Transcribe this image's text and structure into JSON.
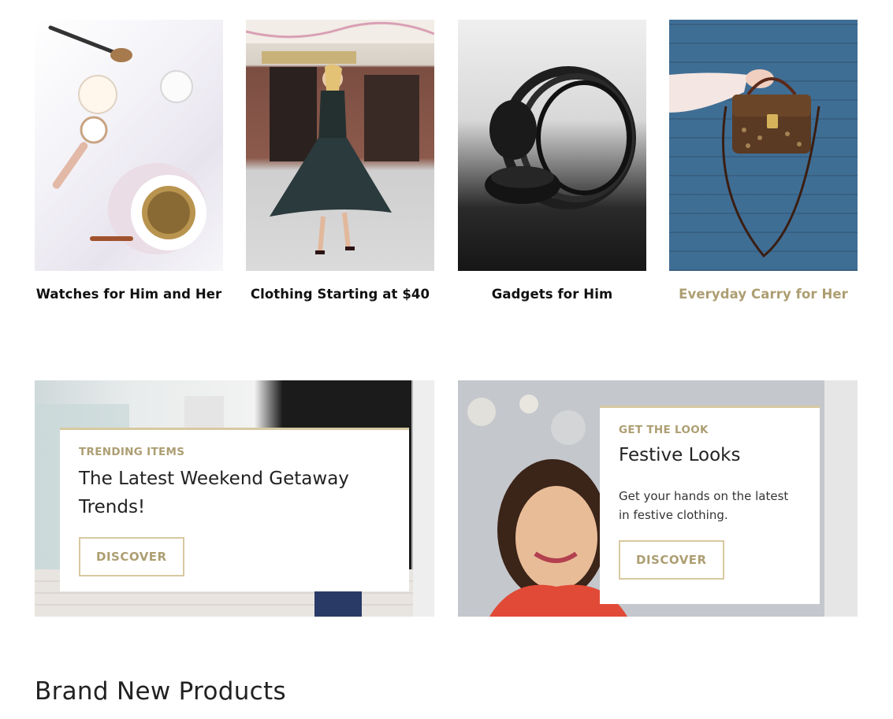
{
  "categories": [
    {
      "label": "Watches for Him and Her",
      "image": "watches-and-coffee-photo"
    },
    {
      "label": "Clothing Starting at $40",
      "image": "woman-in-pleated-dress-photo"
    },
    {
      "label": "Gadgets for Him",
      "image": "headphones-photo"
    },
    {
      "label": "Everyday Carry for Her",
      "image": "handbag-on-blue-wall-photo"
    }
  ],
  "promos": [
    {
      "eyebrow": "TRENDING ITEMS",
      "title": "The Latest Weekend Getaway Trends!",
      "button": "DISCOVER"
    },
    {
      "eyebrow": "GET THE LOOK",
      "title": "Festive Looks",
      "text": "Get your hands on the latest in festive clothing.",
      "button": "DISCOVER"
    }
  ],
  "section_heading": "Brand New Products",
  "colors": {
    "accent": "#ad9e72",
    "accent_border": "#d7c9a0",
    "text": "#111111"
  }
}
